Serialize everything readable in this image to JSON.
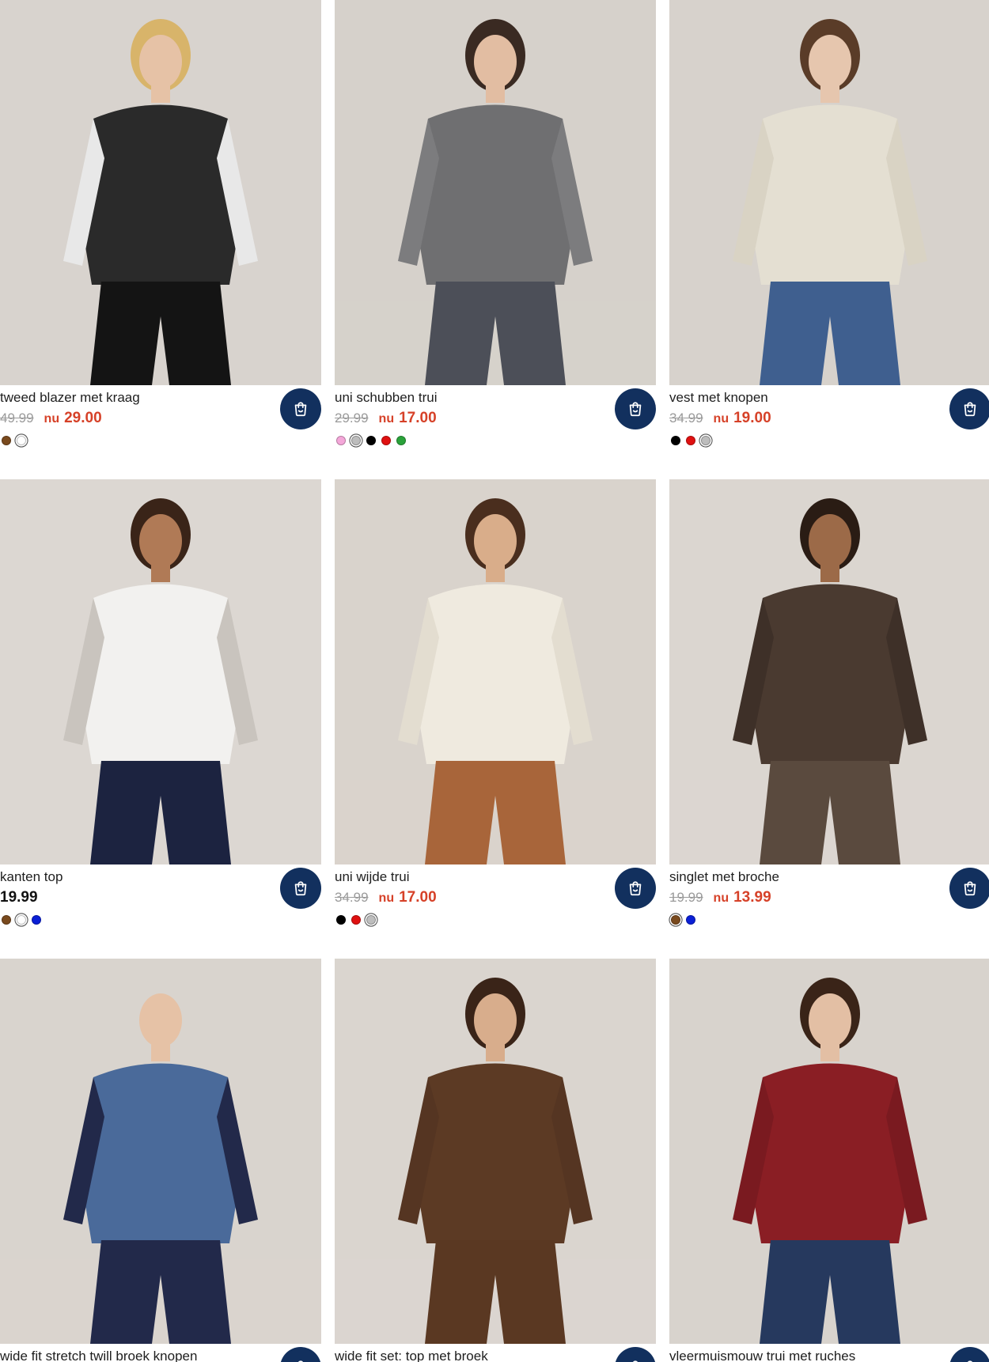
{
  "colors": {
    "accent_button": "#12305e",
    "sale_price": "#d64128",
    "old_price": "#9a9a9a"
  },
  "products": [
    {
      "title": "tweed blazer met kraag",
      "old_price": "49.99",
      "now_label": "nu",
      "price": "29.00",
      "on_sale": true,
      "swatches": [
        {
          "color": "#7a4a1e",
          "selected": false
        },
        {
          "color": "#ffffff",
          "selected": true
        }
      ],
      "cart_icon": "shopping-bag-icon",
      "image": {
        "bg": "#d8d3ce",
        "garment": "#2a2a2a",
        "garment2": "#e8e8e8",
        "bottom": "#141414",
        "hair": "#d8b46a",
        "skin": "#e6c2a6"
      }
    },
    {
      "title": "uni schubben trui",
      "old_price": "29.99",
      "now_label": "nu",
      "price": "17.00",
      "on_sale": true,
      "swatches": [
        {
          "color": "#f4a7d9",
          "selected": false
        },
        {
          "color": "#bdbdbd",
          "selected": true
        },
        {
          "color": "#000000",
          "selected": false
        },
        {
          "color": "#e01010",
          "selected": false
        },
        {
          "color": "#2aa23a",
          "selected": false
        }
      ],
      "cart_icon": "shopping-bag-icon",
      "image": {
        "bg": "#d6d1cb",
        "garment": "#6f6f71",
        "garment2": "#7c7c7e",
        "bottom": "#4c4f58",
        "hair": "#3a2a22",
        "skin": "#e2bda2"
      }
    },
    {
      "title": "vest met knopen",
      "old_price": "34.99",
      "now_label": "nu",
      "price": "19.00",
      "on_sale": true,
      "swatches": [
        {
          "color": "#000000",
          "selected": false
        },
        {
          "color": "#e01010",
          "selected": false
        },
        {
          "color": "#bdbdbd",
          "selected": true
        }
      ],
      "cart_icon": "shopping-bag-icon",
      "image": {
        "bg": "#d7d2cc",
        "garment": "#e4dfd2",
        "garment2": "#d9d3c4",
        "bottom": "#3f5f8f",
        "hair": "#5a3c28",
        "skin": "#e6c6ae"
      }
    },
    {
      "title": "kanten top",
      "old_price": "",
      "now_label": "",
      "price": "19.99",
      "on_sale": false,
      "swatches": [
        {
          "color": "#7a4a1e",
          "selected": false
        },
        {
          "color": "#ffffff",
          "selected": true
        },
        {
          "color": "#0a1fd6",
          "selected": false
        }
      ],
      "cart_icon": "shopping-bag-icon",
      "image": {
        "bg": "#dcd7d2",
        "garment": "#f2f1ef",
        "garment2": "#c9c4be",
        "bottom": "#1c2340",
        "hair": "#3a2418",
        "skin": "#b07a56"
      }
    },
    {
      "title": "uni wijde trui",
      "old_price": "34.99",
      "now_label": "nu",
      "price": "17.00",
      "on_sale": true,
      "swatches": [
        {
          "color": "#000000",
          "selected": false
        },
        {
          "color": "#e01010",
          "selected": false
        },
        {
          "color": "#bdbdbd",
          "selected": true
        }
      ],
      "cart_icon": "shopping-bag-icon",
      "image": {
        "bg": "#d9d3cc",
        "garment": "#efeadf",
        "garment2": "#e3ddd0",
        "bottom": "#a8653a",
        "hair": "#4a2e1e",
        "skin": "#d9ad8a"
      }
    },
    {
      "title": "singlet met broche",
      "old_price": "19.99",
      "now_label": "nu",
      "price": "13.99",
      "on_sale": true,
      "swatches": [
        {
          "color": "#7a4a1e",
          "selected": true
        },
        {
          "color": "#0a1fd6",
          "selected": false
        }
      ],
      "cart_icon": "shopping-bag-icon",
      "image": {
        "bg": "#dbd6d0",
        "garment": "#4a3a30",
        "garment2": "#3e3028",
        "bottom": "#5a4a3e",
        "hair": "#2a1c14",
        "skin": "#9c6a48"
      }
    },
    {
      "title": "wide fit stretch twill broek knopen",
      "old_price": "",
      "now_label": "",
      "price": "",
      "on_sale": false,
      "swatches": [],
      "cart_icon": "shopping-bag-icon",
      "image": {
        "bg": "#d9d4ce",
        "garment": "#4a6a9a",
        "garment2": "#22294a",
        "bottom": "#22294a",
        "hair": "#d9d4ce",
        "skin": "#e6c2a6"
      }
    },
    {
      "title": "wide fit set: top met broek",
      "old_price": "",
      "now_label": "",
      "price": "",
      "on_sale": false,
      "swatches": [],
      "cart_icon": "shopping-bag-icon",
      "image": {
        "bg": "#dad5cf",
        "garment": "#5c3a24",
        "garment2": "#553522",
        "bottom": "#5a3822",
        "hair": "#3a2418",
        "skin": "#d8ad8c"
      }
    },
    {
      "title": "vleermuismouw trui met ruches",
      "old_price": "",
      "now_label": "",
      "price": "",
      "on_sale": false,
      "swatches": [],
      "cart_icon": "shopping-bag-icon",
      "image": {
        "bg": "#d8d3cd",
        "garment": "#8a1e24",
        "garment2": "#7a1a20",
        "bottom": "#26395e",
        "hair": "#3a2418",
        "skin": "#e3bfa4"
      }
    }
  ]
}
